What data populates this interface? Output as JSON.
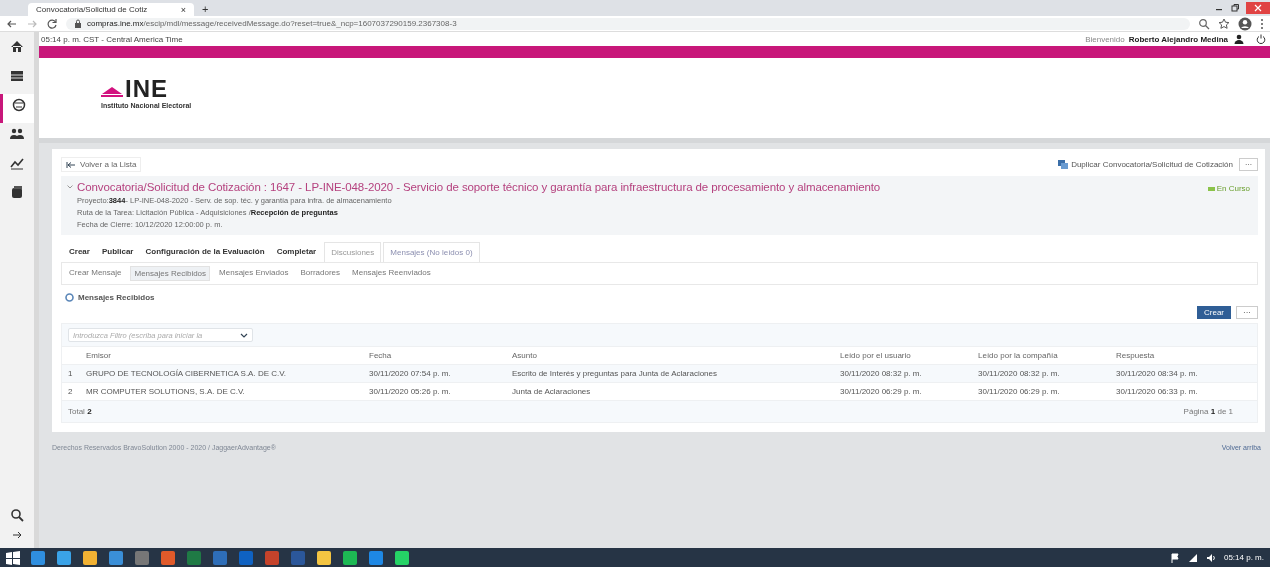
{
  "browser": {
    "tab_title": "Convocatoria/Solicitud de Cotiz",
    "tab_close": "×",
    "new_tab": "+",
    "url_host": "compras.ine.mx",
    "url_path": "/escip/mdl/message/receivedMessage.do?reset=true&_ncp=1607037290159.2367308-3"
  },
  "sidebar": {
    "items": [
      {
        "selected": false
      },
      {
        "selected": false
      },
      {
        "selected": true
      },
      {
        "selected": false
      },
      {
        "selected": false
      },
      {
        "selected": false
      }
    ]
  },
  "top_bar": {
    "time": "05:14 p. m. CST - Central America Time",
    "welcome": "Bienvenido",
    "user_name": "Roberto Alejandro Medina"
  },
  "logo": {
    "name": "INE",
    "subtitle": "Instituto Nacional Electoral"
  },
  "back_link": "Volver a la Lista",
  "duplicate_link": "Duplicar Convocatoria/Solicitud de Cotización",
  "more_button": "···",
  "header": {
    "title": "Convocatoria/Solicitud de Cotización : 1647 - LP-INE-048-2020 - Servicio de soporte técnico y garantía para infraestructura de procesamiento y almacenamiento",
    "project": "Proyecto:**3844**- LP-INE-048-2020 - Serv. de sop. téc. y garantía para infra. de almacenamiento",
    "route": "Ruta de la Tarea: Licitación Pública - Adquisiciones /**Recepción de preguntas**",
    "close_date": "Fecha de Cierre: 10/12/2020 12:00:00 p. m.",
    "status": "En Curso"
  },
  "tabs": [
    {
      "label": "Crear",
      "kind": "action",
      "selected": false
    },
    {
      "label": "Publicar",
      "kind": "action",
      "selected": false
    },
    {
      "label": "Configuración de la Evaluación",
      "kind": "action",
      "selected": false
    },
    {
      "label": "Completar",
      "kind": "action",
      "selected": false
    },
    {
      "label": "Discusiones",
      "kind": "tab",
      "selected": false
    },
    {
      "label": "Mensajes (No leídos 0)",
      "kind": "tab",
      "selected": true
    }
  ],
  "subtabs": [
    {
      "label": "Crear Mensaje",
      "selected": false
    },
    {
      "label": "Mensajes Recibidos",
      "selected": true
    },
    {
      "label": "Mensajes Enviados",
      "selected": false
    },
    {
      "label": "Borradores",
      "selected": false
    },
    {
      "label": "Mensajes Reenviados",
      "selected": false
    }
  ],
  "section_title": "Mensajes Recibidos",
  "buttons": [
    {
      "label": "Crear",
      "kind": "primary"
    },
    {
      "label": "···",
      "kind": "secondary"
    }
  ],
  "filter": {
    "placeholder": "Introduzca Filtro (escriba para iniciar la"
  },
  "table": {
    "columns": [
      "Emisor",
      "Fecha",
      "Asunto",
      "Leído por el usuario",
      "Leído por la compañía",
      "Respuesta"
    ],
    "rows": [
      {
        "number": "1",
        "cells": [
          "GRUPO DE TECNOLOGÍA CIBERNETICA S.A. DE C.V.",
          "30/11/2020 07:54 p. m.",
          "Escrito de Interés y preguntas para Junta de Aclaraciones",
          "30/11/2020 08:32 p. m.",
          "30/11/2020 08:32 p. m.",
          "30/11/2020 08:34 p. m."
        ]
      },
      {
        "number": "2",
        "cells": [
          "MR COMPUTER SOLUTIONS, S.A. DE C.V.",
          "30/11/2020 05:26 p. m.",
          "Junta de Aclaraciones",
          "30/11/2020 06:29 p. m.",
          "30/11/2020 06:29 p. m.",
          "30/11/2020 06:33 p. m."
        ]
      }
    ],
    "total": "Total **2**",
    "pagination": "Página **1** de 1"
  },
  "footer": {
    "copyright": "Derechos Reservados BravoSolution 2000 - 2020 / JaggaerAdvantage®",
    "back_to_top": "Volver arriba"
  },
  "taskbar": {
    "time": "05:14 p. m."
  }
}
